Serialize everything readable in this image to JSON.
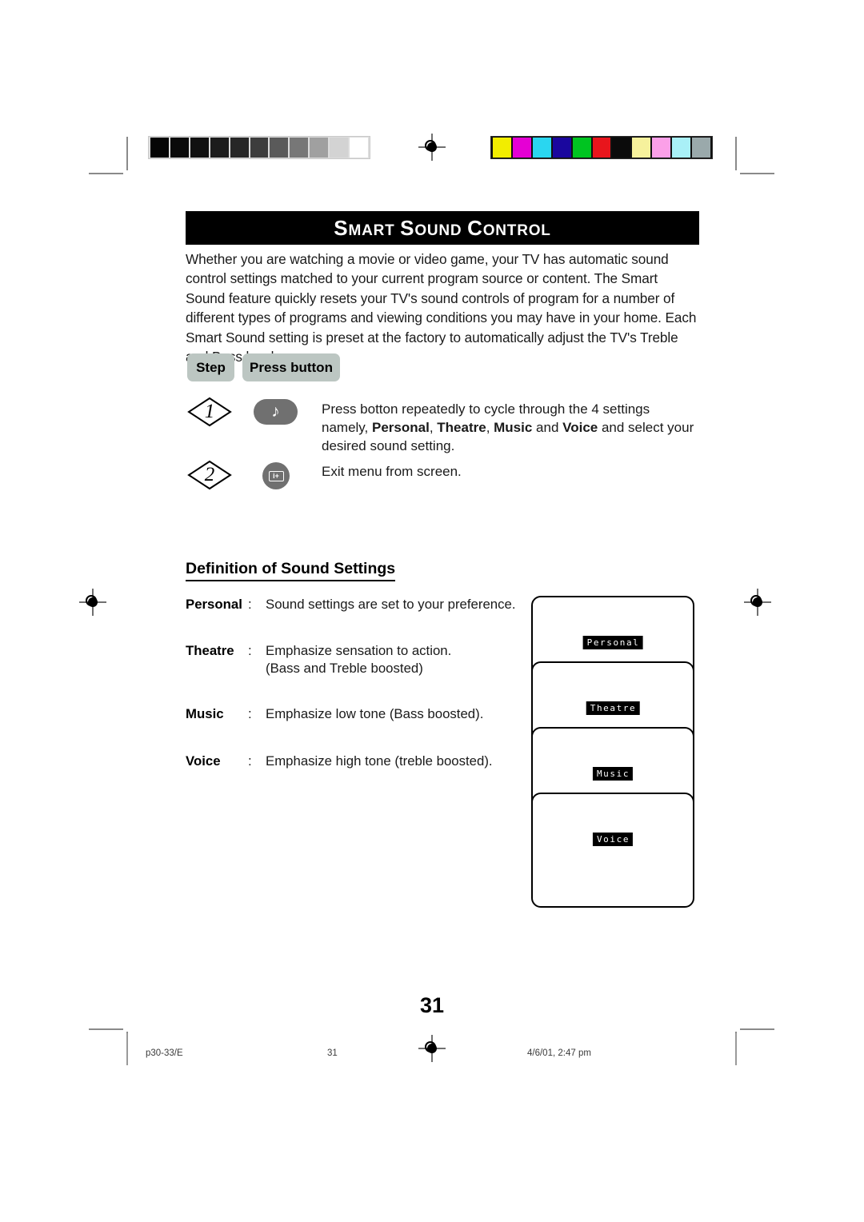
{
  "document": {
    "title": "Smart Sound Control",
    "title_display": {
      "words": [
        {
          "cap": "S",
          "rest": "MART"
        },
        {
          "cap": "S",
          "rest": "OUND"
        },
        {
          "cap": "C",
          "rest": "ONTROL"
        }
      ]
    },
    "page_number": "31"
  },
  "intro": {
    "paragraph": "Whether you are watching a movie or video game, your TV has automatic sound control settings matched to your current program source or content. The Smart Sound feature quickly resets your TV's sound controls of program for a number of different types of programs and viewing conditions you may have in your home. Each Smart Sound setting is preset at the factory to automatically adjust the TV's Treble and Bass levels."
  },
  "steps_table": {
    "header": {
      "step_label": "Step",
      "press_button_label": "Press button"
    },
    "rows": [
      {
        "number": "1",
        "button_icon": "music-note-icon",
        "button_glyph": "♪",
        "text_before": "Press botton repeatedly to cycle through the 4 settings namely,",
        "bold_terms": [
          "Personal",
          "Theatre",
          "Music",
          "Voice"
        ],
        "text_after": "and select your desired sound setting."
      },
      {
        "number": "2",
        "button_icon": "info-plus-icon",
        "button_glyph": "i+",
        "text": "Exit menu from screen."
      }
    ]
  },
  "definitions": {
    "heading": "Definition of Sound Settings",
    "items": [
      {
        "term": "Personal",
        "separator": ":",
        "description": "Sound settings are set to your preference.",
        "sub": ""
      },
      {
        "term": "Theatre",
        "separator": ":",
        "description": "Emphasize sensation to action.",
        "sub": "(Bass and Treble boosted)"
      },
      {
        "term": "Music",
        "separator": ":",
        "description": "Emphasize low tone (Bass boosted).",
        "sub": ""
      },
      {
        "term": "Voice",
        "separator": ":",
        "description": "Emphasize high tone (treble boosted).",
        "sub": ""
      }
    ]
  },
  "tv_screens": [
    {
      "osd_label": "Personal"
    },
    {
      "osd_label": "Theatre"
    },
    {
      "osd_label": "Music"
    },
    {
      "osd_label": "Voice"
    }
  ],
  "footer": {
    "file_name": "p30-33/E",
    "page": "31",
    "timestamp": "4/6/01, 2:47 pm"
  },
  "calibration": {
    "grayscale_steps": [
      "#050505",
      "#0a0a0a",
      "#111111",
      "#1c1c1c",
      "#272727",
      "#3d3d3d",
      "#5a5a5a",
      "#777777",
      "#a0a0a0",
      "#d3d3d3",
      "#ffffff"
    ],
    "color_steps": [
      "#f2ed00",
      "#e500d4",
      "#2ad6f0",
      "#1a079e",
      "#00c421",
      "#e8151c",
      "#0b0b0b",
      "#f6f19c",
      "#fba0e8",
      "#a9f0f7",
      "#9aa9ab"
    ]
  }
}
